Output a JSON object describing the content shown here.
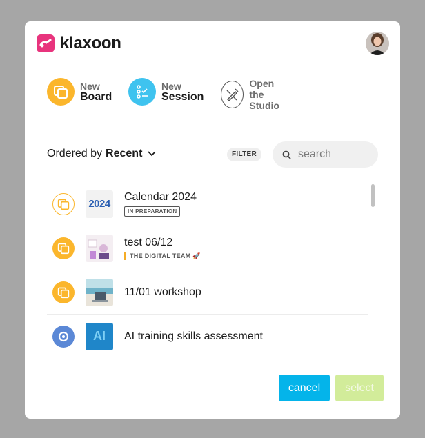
{
  "brand": {
    "name": "klaxoon",
    "color": "#e8347d"
  },
  "user": {
    "avatar_icon": "user-avatar"
  },
  "actions": [
    {
      "top": "New",
      "bottom": "Board",
      "icon": "board-icon",
      "color": "#fbb62c"
    },
    {
      "top": "New",
      "bottom": "Session",
      "icon": "session-icon",
      "color": "#3fc3ef"
    },
    {
      "top": "Open the",
      "bottom": "Studio",
      "icon": "studio-icon",
      "color": "#5b5b5b"
    }
  ],
  "sort": {
    "label": "Ordered by",
    "value": "Recent"
  },
  "filter": {
    "label": "FILTER"
  },
  "search": {
    "placeholder": "search",
    "value": ""
  },
  "items": [
    {
      "title": "Calendar 2024",
      "type": "board",
      "badge": "IN PREPARATION",
      "thumb_text": "2024"
    },
    {
      "title": "test 06/12",
      "type": "board",
      "team": "THE DIGITAL TEAM",
      "team_icon": "rocket-icon"
    },
    {
      "title": "11/01 workshop",
      "type": "board"
    },
    {
      "title": "AI training skills assessment",
      "type": "session",
      "thumb_text": "AI"
    }
  ],
  "buttons": {
    "cancel": "cancel",
    "select": "select"
  },
  "colors": {
    "accent": "#04b4ea",
    "board": "#fbb62c",
    "session": "#5b88d6",
    "select_disabled": "#d2ec9a"
  }
}
